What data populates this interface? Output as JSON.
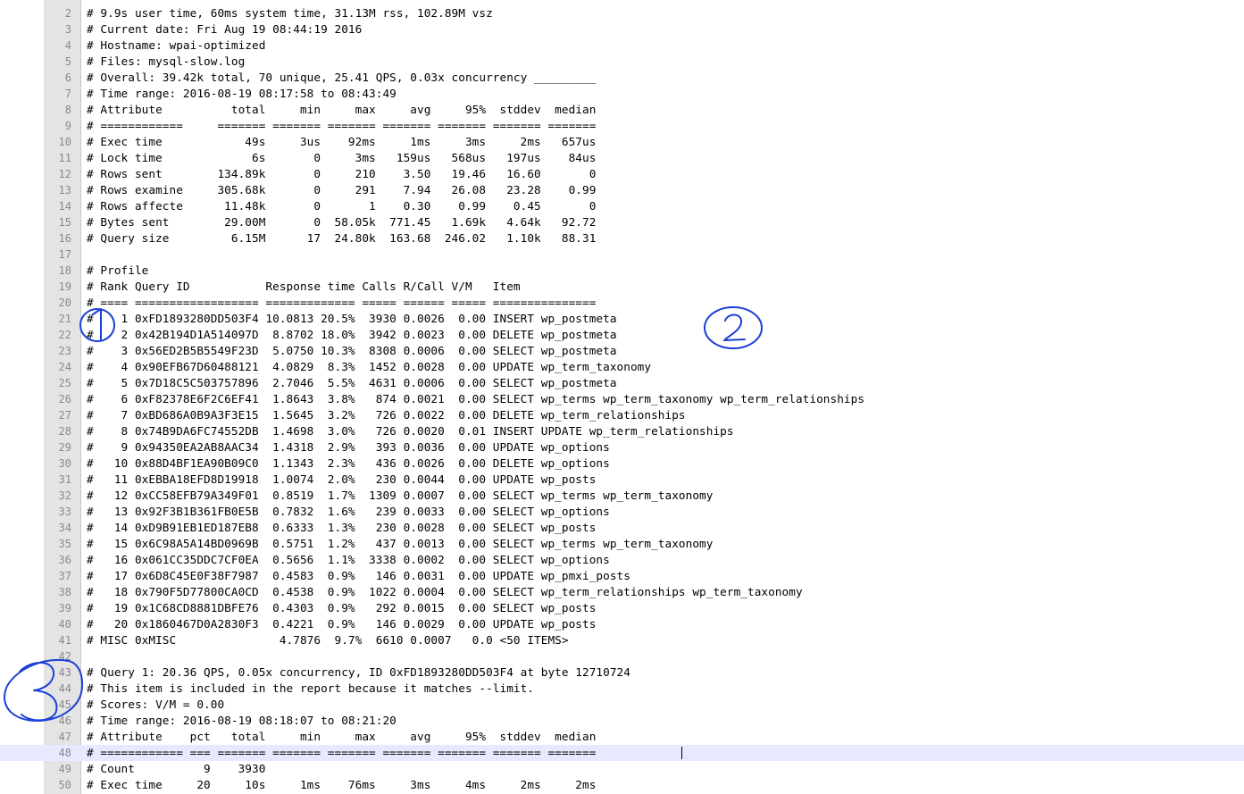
{
  "editor": {
    "lines": [
      {
        "n": "2",
        "text": "# 9.9s user time, 60ms system time, 31.13M rss, 102.89M vsz"
      },
      {
        "n": "3",
        "text": "# Current date: Fri Aug 19 08:44:19 2016"
      },
      {
        "n": "4",
        "text": "# Hostname: wpai-optimized"
      },
      {
        "n": "5",
        "text": "# Files: mysql-slow.log"
      },
      {
        "n": "6",
        "text": "# Overall: 39.42k total, 70 unique, 25.41 QPS, 0.03x concurrency _________"
      },
      {
        "n": "7",
        "text": "# Time range: 2016-08-19 08:17:58 to 08:43:49"
      },
      {
        "n": "8",
        "text": "# Attribute          total     min     max     avg     95%  stddev  median"
      },
      {
        "n": "9",
        "text": "# ============     ======= ======= ======= ======= ======= ======= ======="
      },
      {
        "n": "10",
        "text": "# Exec time            49s     3us    92ms     1ms     3ms     2ms   657us"
      },
      {
        "n": "11",
        "text": "# Lock time             6s       0     3ms   159us   568us   197us    84us"
      },
      {
        "n": "12",
        "text": "# Rows sent        134.89k       0     210    3.50   19.46   16.60       0"
      },
      {
        "n": "13",
        "text": "# Rows examine     305.68k       0     291    7.94   26.08   23.28    0.99"
      },
      {
        "n": "14",
        "text": "# Rows affecte      11.48k       0       1    0.30    0.99    0.45       0"
      },
      {
        "n": "15",
        "text": "# Bytes sent        29.00M       0  58.05k  771.45   1.69k   4.64k   92.72"
      },
      {
        "n": "16",
        "text": "# Query size         6.15M      17  24.80k  163.68  246.02   1.10k   88.31"
      },
      {
        "n": "17",
        "text": ""
      },
      {
        "n": "18",
        "text": "# Profile"
      },
      {
        "n": "19",
        "text": "# Rank Query ID           Response time Calls R/Call V/M   Item"
      },
      {
        "n": "20",
        "text": "# ==== ================== ============= ===== ====== ===== ==============="
      },
      {
        "n": "21",
        "text": "#    1 0xFD1893280DD503F4 10.0813 20.5%  3930 0.0026  0.00 INSERT wp_postmeta"
      },
      {
        "n": "22",
        "text": "#    2 0x42B194D1A514097D  8.8702 18.0%  3942 0.0023  0.00 DELETE wp_postmeta"
      },
      {
        "n": "23",
        "text": "#    3 0x56ED2B5B5549F23D  5.0750 10.3%  8308 0.0006  0.00 SELECT wp_postmeta"
      },
      {
        "n": "24",
        "text": "#    4 0x90EFB67D60488121  4.0829  8.3%  1452 0.0028  0.00 UPDATE wp_term_taxonomy"
      },
      {
        "n": "25",
        "text": "#    5 0x7D18C5C503757896  2.7046  5.5%  4631 0.0006  0.00 SELECT wp_postmeta"
      },
      {
        "n": "26",
        "text": "#    6 0xF82378E6F2C6EF41  1.8643  3.8%   874 0.0021  0.00 SELECT wp_terms wp_term_taxonomy wp_term_relationships"
      },
      {
        "n": "27",
        "text": "#    7 0xBD686A0B9A3F3E15  1.5645  3.2%   726 0.0022  0.00 DELETE wp_term_relationships"
      },
      {
        "n": "28",
        "text": "#    8 0x74B9DA6FC74552DB  1.4698  3.0%   726 0.0020  0.01 INSERT UPDATE wp_term_relationships"
      },
      {
        "n": "29",
        "text": "#    9 0x94350EA2AB8AAC34  1.4318  2.9%   393 0.0036  0.00 UPDATE wp_options"
      },
      {
        "n": "30",
        "text": "#   10 0x88D4BF1EA90B09C0  1.1343  2.3%   436 0.0026  0.00 DELETE wp_options"
      },
      {
        "n": "31",
        "text": "#   11 0xEBBA18EFD8D19918  1.0074  2.0%   230 0.0044  0.00 UPDATE wp_posts"
      },
      {
        "n": "32",
        "text": "#   12 0xCC58EFB79A349F01  0.8519  1.7%  1309 0.0007  0.00 SELECT wp_terms wp_term_taxonomy"
      },
      {
        "n": "33",
        "text": "#   13 0x92F3B1B361FB0E5B  0.7832  1.6%   239 0.0033  0.00 SELECT wp_options"
      },
      {
        "n": "34",
        "text": "#   14 0xD9B91EB1ED187EB8  0.6333  1.3%   230 0.0028  0.00 SELECT wp_posts"
      },
      {
        "n": "35",
        "text": "#   15 0x6C98A5A14BD0969B  0.5751  1.2%   437 0.0013  0.00 SELECT wp_terms wp_term_taxonomy"
      },
      {
        "n": "36",
        "text": "#   16 0x061CC35DDC7CF0EA  0.5656  1.1%  3338 0.0002  0.00 SELECT wp_options"
      },
      {
        "n": "37",
        "text": "#   17 0x6D8C45E0F38F7987  0.4583  0.9%   146 0.0031  0.00 UPDATE wp_pmxi_posts"
      },
      {
        "n": "38",
        "text": "#   18 0x790F5D77800CA0CD  0.4538  0.9%  1022 0.0004  0.00 SELECT wp_term_relationships wp_term_taxonomy"
      },
      {
        "n": "39",
        "text": "#   19 0x1C68CD8881DBFE76  0.4303  0.9%   292 0.0015  0.00 SELECT wp_posts"
      },
      {
        "n": "40",
        "text": "#   20 0x1860467D0A2830F3  0.4221  0.9%   146 0.0029  0.00 UPDATE wp_posts"
      },
      {
        "n": "41",
        "text": "# MISC 0xMISC               4.7876  9.7%  6610 0.0007   0.0 <50 ITEMS>"
      },
      {
        "n": "42",
        "text": ""
      },
      {
        "n": "43",
        "text": "# Query 1: 20.36 QPS, 0.05x concurrency, ID 0xFD1893280DD503F4 at byte 12710724"
      },
      {
        "n": "44",
        "text": "# This item is included in the report because it matches --limit."
      },
      {
        "n": "45",
        "text": "# Scores: V/M = 0.00"
      },
      {
        "n": "46",
        "text": "# Time range: 2016-08-19 08:18:07 to 08:21:20"
      },
      {
        "n": "47",
        "text": "# Attribute    pct   total     min     max     avg     95%  stddev  median"
      },
      {
        "n": "48",
        "text": "# ============ === ======= ======= ======= ======= ======= ======= =======",
        "current": true
      },
      {
        "n": "49",
        "text": "# Count          9    3930"
      },
      {
        "n": "50",
        "text": "# Exec time     20     10s     1ms    76ms     3ms     4ms     2ms     2ms"
      }
    ]
  },
  "annotations": {
    "circle_1_label": "1",
    "circle_2_label": "2",
    "circle_3_label": "3",
    "stroke_color": "#1b3fd6"
  }
}
